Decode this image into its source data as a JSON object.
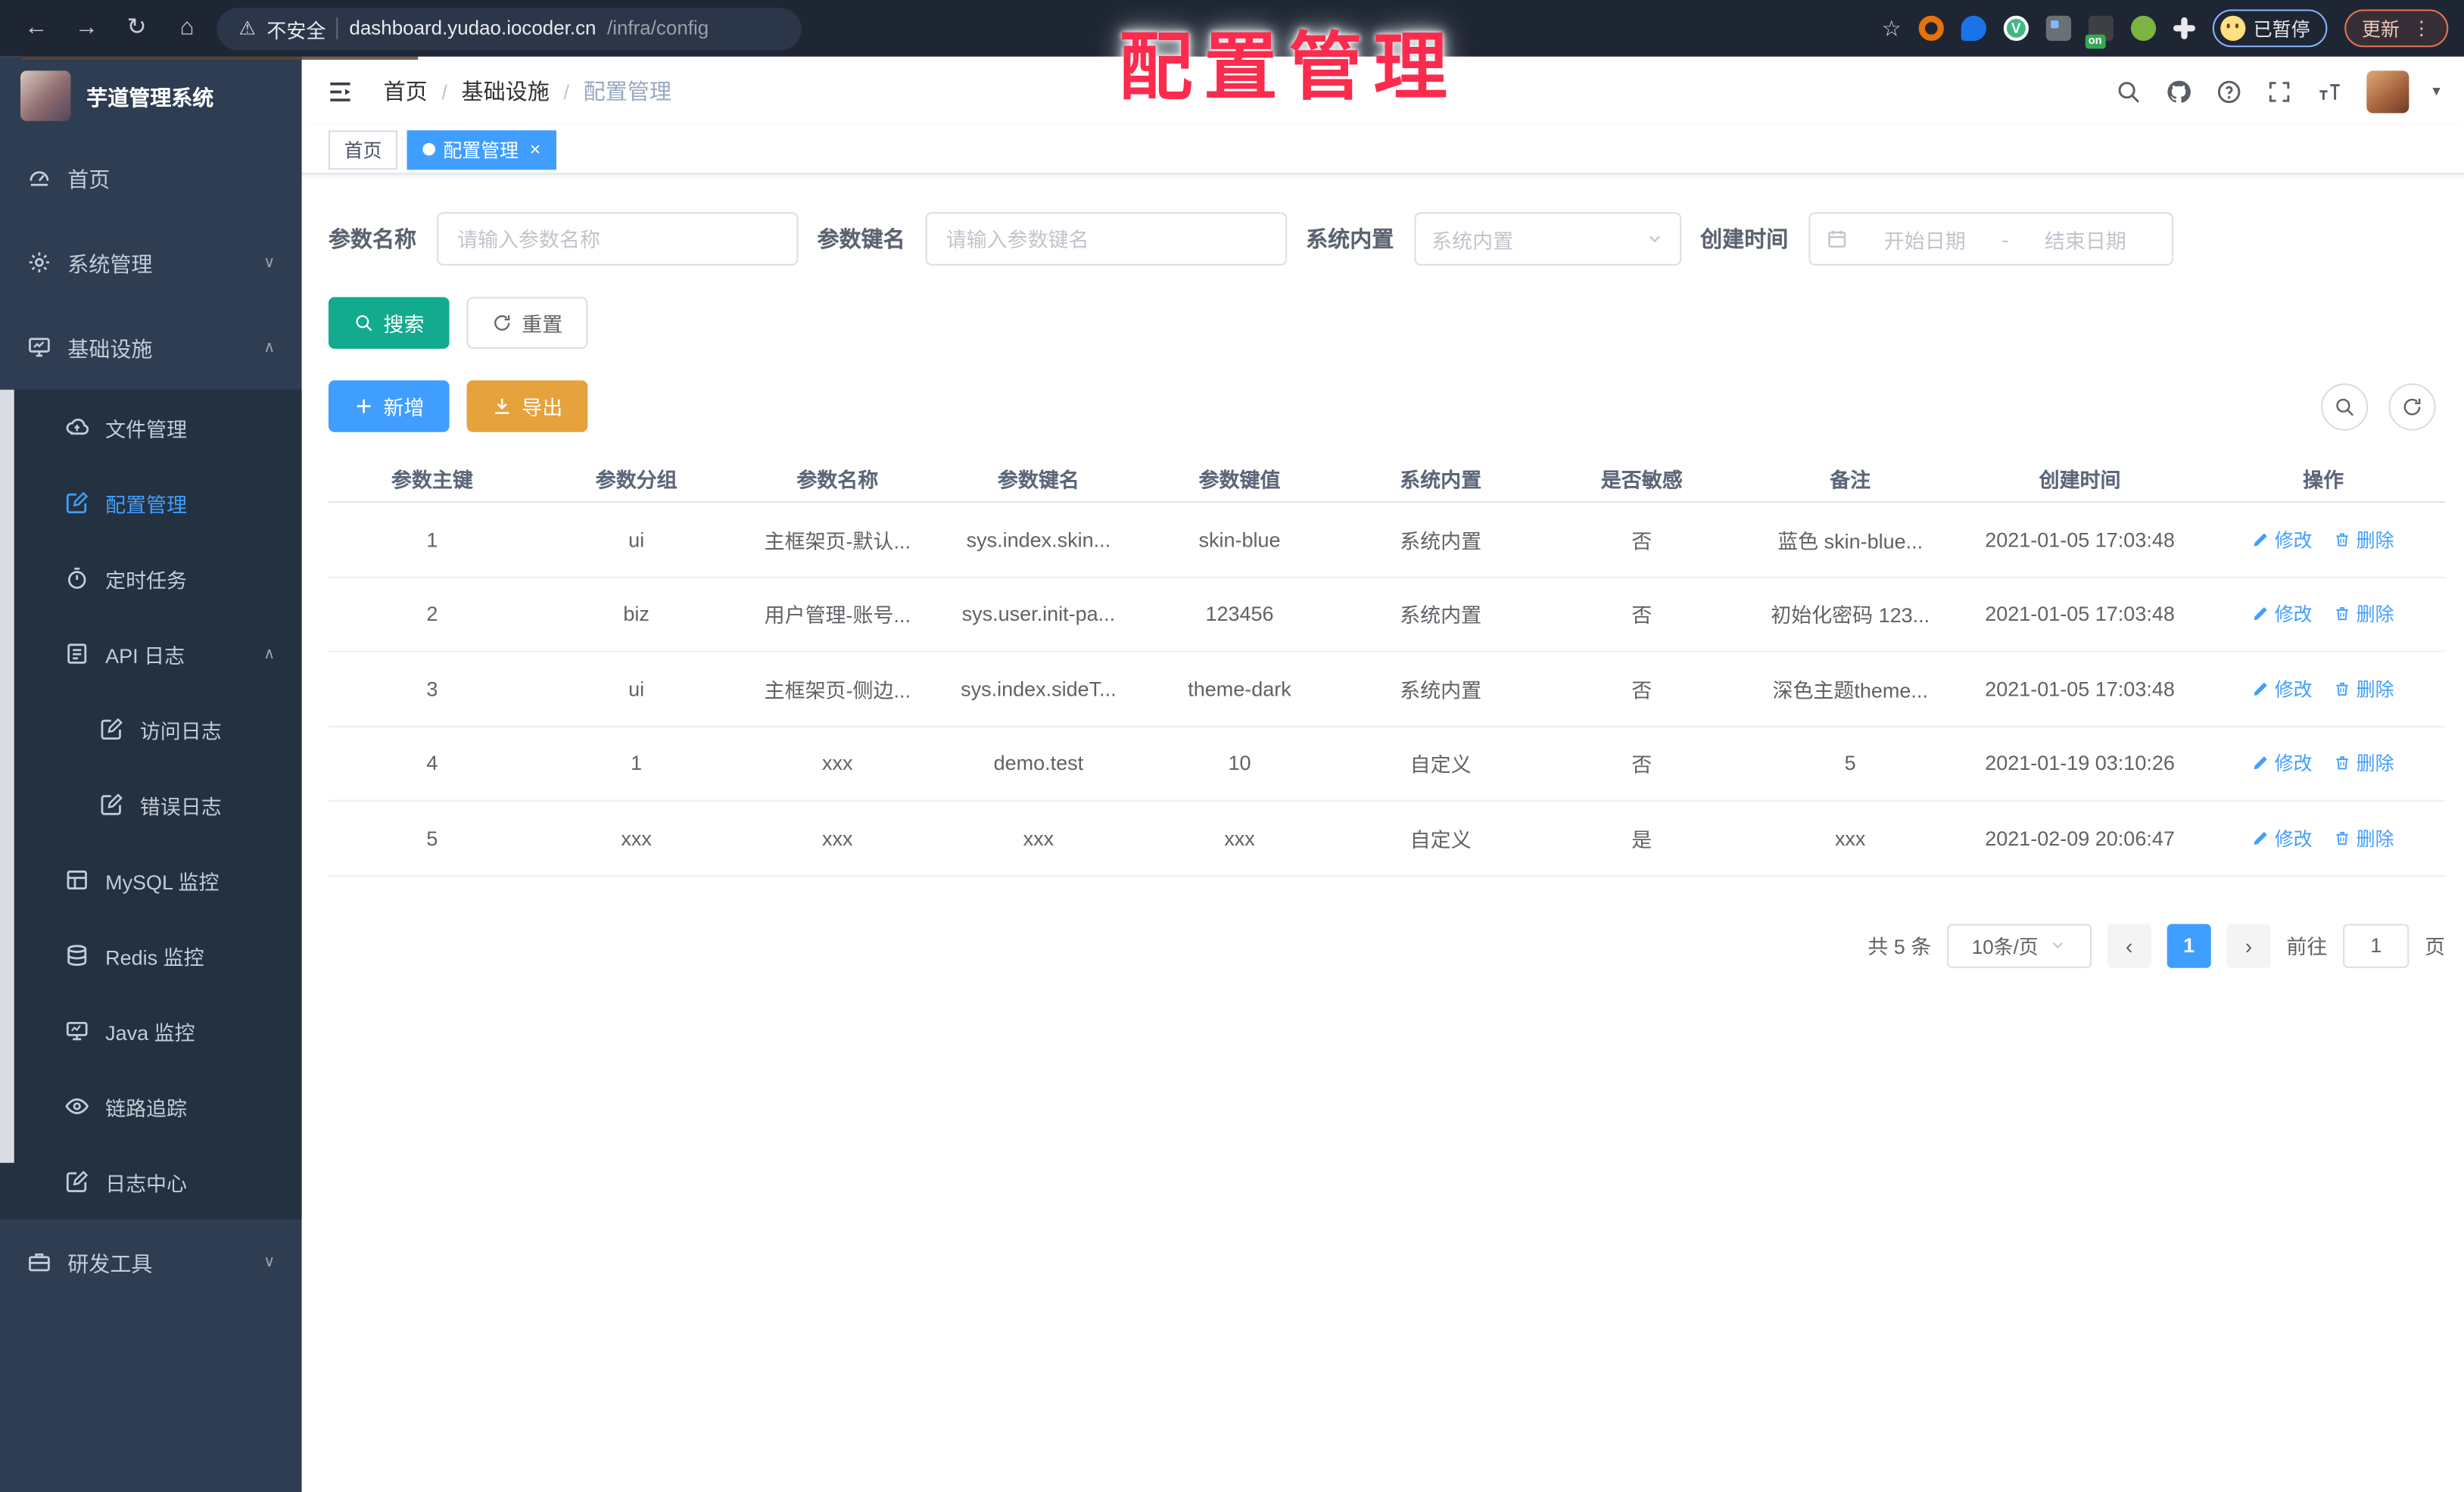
{
  "glyphs": {
    "back": "←",
    "forward": "→",
    "reload": "↻",
    "home": "⌂",
    "warning": "⚠",
    "star": "☆",
    "dots": "⋮",
    "vue": "V",
    "caret": "▾",
    "prev": "‹",
    "next": "›",
    "close": "×",
    "range_separator": "-",
    "chevron_down": "∨",
    "chevron_up": "∧"
  },
  "browser": {
    "security_label": "不安全",
    "url_host": "dashboard.yudao.iocoder.cn",
    "url_path": "/infra/config",
    "extension_on_badge": "on",
    "paused_badge": "已暂停",
    "update_button": "更新"
  },
  "watermark": "配置管理",
  "sidebar": {
    "title": "芋道管理系统",
    "menu": [
      {
        "label": "首页"
      },
      {
        "label": "系统管理",
        "chevron": "∨"
      },
      {
        "label": "基础设施",
        "chevron": "∧"
      },
      {
        "label": "文件管理"
      },
      {
        "label": "配置管理",
        "active": true
      },
      {
        "label": "定时任务"
      },
      {
        "label": "API 日志",
        "chevron": "∧"
      },
      {
        "label": "访问日志"
      },
      {
        "label": "错误日志"
      },
      {
        "label": "MySQL 监控"
      },
      {
        "label": "Redis 监控"
      },
      {
        "label": "Java 监控"
      },
      {
        "label": "链路追踪"
      },
      {
        "label": "日志中心"
      },
      {
        "label": "研发工具",
        "chevron": "∨"
      }
    ]
  },
  "header": {
    "breadcrumb": [
      "首页",
      "基础设施",
      "配置管理"
    ],
    "separator": "/"
  },
  "tags": {
    "items": [
      {
        "label": "首页"
      },
      {
        "label": "配置管理"
      }
    ]
  },
  "filters": {
    "name": {
      "label": "参数名称",
      "placeholder": "请输入参数名称"
    },
    "key": {
      "label": "参数键名",
      "placeholder": "请输入参数键名"
    },
    "builtin": {
      "label": "系统内置",
      "placeholder": "系统内置"
    },
    "created": {
      "label": "创建时间",
      "start_placeholder": "开始日期",
      "end_placeholder": "结束日期"
    }
  },
  "toolbar": {
    "search": "搜索",
    "reset": "重置",
    "add": "新增",
    "export": "导出"
  },
  "table": {
    "columns": [
      "参数主键",
      "参数分组",
      "参数名称",
      "参数键名",
      "参数键值",
      "系统内置",
      "是否敏感",
      "备注",
      "创建时间",
      "操作"
    ],
    "edit_label": "修改",
    "delete_label": "删除",
    "rows": [
      [
        "1",
        "ui",
        "主框架页-默认...",
        "sys.index.skin...",
        "skin-blue",
        "系统内置",
        "否",
        "蓝色 skin-blue...",
        "2021-01-05 17:03:48"
      ],
      [
        "2",
        "biz",
        "用户管理-账号...",
        "sys.user.init-pa...",
        "123456",
        "系统内置",
        "否",
        "初始化密码 123...",
        "2021-01-05 17:03:48"
      ],
      [
        "3",
        "ui",
        "主框架页-侧边...",
        "sys.index.sideT...",
        "theme-dark",
        "系统内置",
        "否",
        "深色主题theme...",
        "2021-01-05 17:03:48"
      ],
      [
        "4",
        "1",
        "xxx",
        "demo.test",
        "10",
        "自定义",
        "否",
        "5",
        "2021-01-19 03:10:26"
      ],
      [
        "5",
        "xxx",
        "xxx",
        "xxx",
        "xxx",
        "自定义",
        "是",
        "xxx",
        "2021-02-09 20:06:47"
      ]
    ]
  },
  "pagination": {
    "total": "共 5 条",
    "page_size": "10条/页",
    "current": "1",
    "goto_label": "前往",
    "goto_value": "1",
    "page_label": "页"
  },
  "colors": {
    "accent": "#409eff",
    "active_tag": "#409eff",
    "search_button": "#12ab8d",
    "export_button": "#e6a23c",
    "watermark": "#fb2b4e",
    "sidebar_bg": "#2f3d52",
    "submenu_bg": "#243140"
  }
}
